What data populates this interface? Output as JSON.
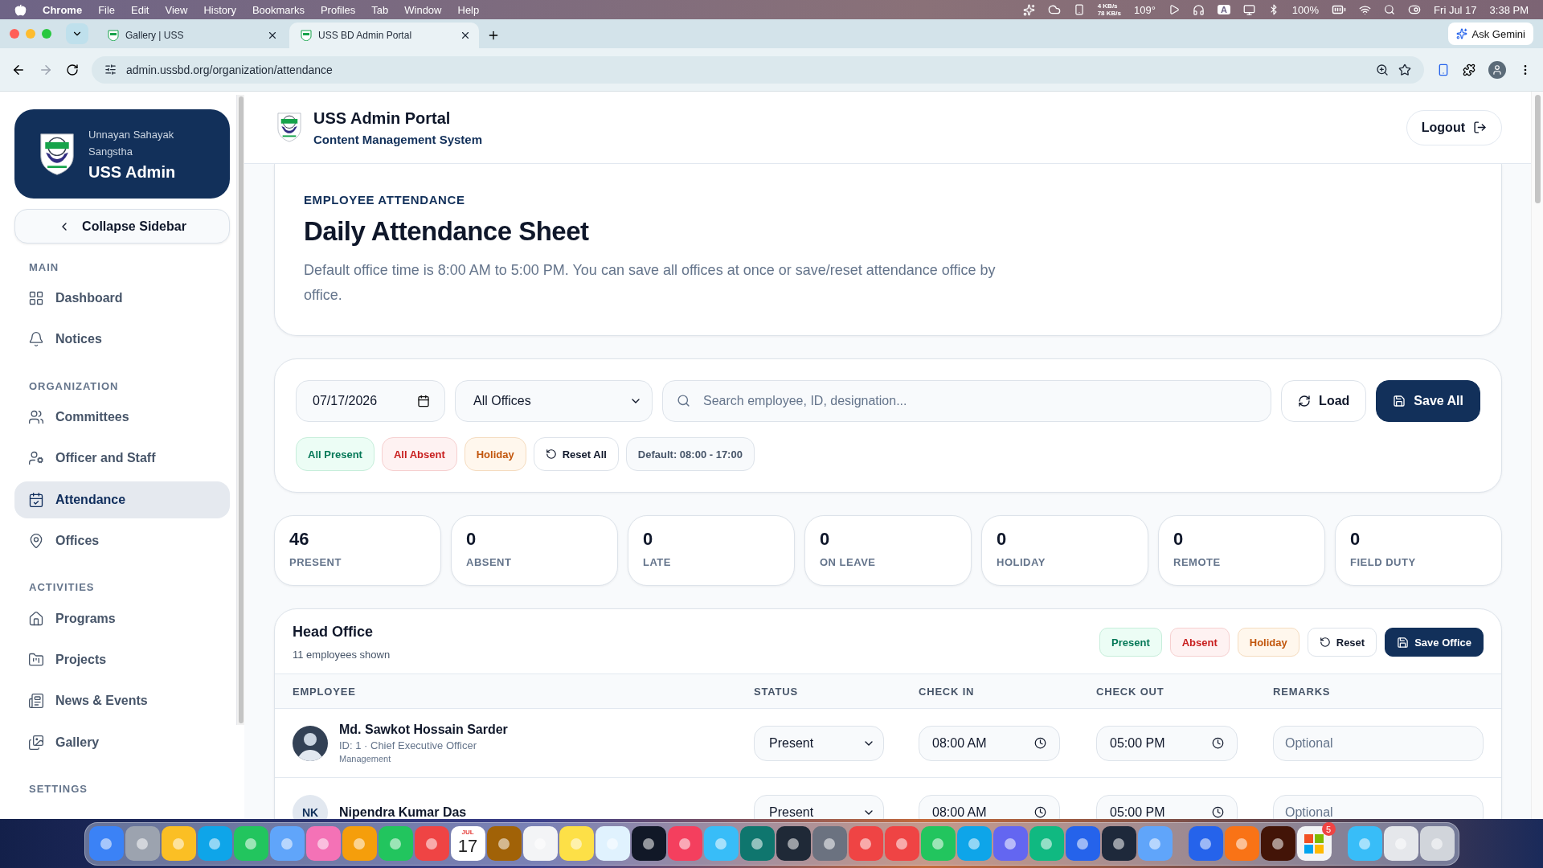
{
  "menu_bar": {
    "app": "Chrome",
    "menus": [
      "File",
      "Edit",
      "View",
      "History",
      "Bookmarks",
      "Profiles",
      "Tab",
      "Window",
      "Help"
    ],
    "net_up": "4 KB/s",
    "net_down": "78 KB/s",
    "temperature": "109°",
    "input_source": "A",
    "battery": "100%",
    "date": "Fri Jul 17",
    "time": "3:38 PM"
  },
  "browser": {
    "tabs": [
      {
        "title": "Gallery | USS",
        "selected": false
      },
      {
        "title": "USS BD Admin Portal",
        "selected": true
      }
    ],
    "ask_button": "Ask Gemini",
    "url": "admin.ussbd.org/organization/attendance"
  },
  "sidebar": {
    "org_name": "Unnayan Sahayak Sangstha",
    "brand": "USS Admin",
    "collapse": "Collapse Sidebar",
    "sections": [
      {
        "title": "MAIN",
        "items": [
          {
            "label": "Dashboard",
            "selected": false
          },
          {
            "label": "Notices",
            "selected": false
          }
        ]
      },
      {
        "title": "ORGANIZATION",
        "items": [
          {
            "label": "Committees",
            "selected": false
          },
          {
            "label": "Officer and Staff",
            "selected": false
          },
          {
            "label": "Attendance",
            "selected": true
          },
          {
            "label": "Offices",
            "selected": false
          }
        ]
      },
      {
        "title": "ACTIVITIES",
        "items": [
          {
            "label": "Programs",
            "selected": false
          },
          {
            "label": "Projects",
            "selected": false
          },
          {
            "label": "News & Events",
            "selected": false
          },
          {
            "label": "Gallery",
            "selected": false
          }
        ]
      },
      {
        "title": "SETTINGS"
      }
    ]
  },
  "header": {
    "title": "USS Admin Portal",
    "subtitle": "Content Management System",
    "logout": "Logout"
  },
  "intro": {
    "eyebrow": "EMPLOYEE ATTENDANCE",
    "title": "Daily Attendance Sheet",
    "description": "Default office time is 8:00 AM to 5:00 PM. You can save all offices at once or save/reset attendance office by office."
  },
  "filters": {
    "date": "07/17/2026",
    "office": "All Offices",
    "search_placeholder": "Search employee, ID, designation...",
    "load": "Load",
    "save_all": "Save All",
    "quick_actions": [
      {
        "label": "All Present",
        "kind": "present"
      },
      {
        "label": "All Absent",
        "kind": "absent"
      },
      {
        "label": "Holiday",
        "kind": "holiday"
      },
      {
        "label": "Reset All",
        "kind": "reset"
      },
      {
        "label": "Default: 08:00 - 17:00",
        "kind": "info"
      }
    ]
  },
  "stats": [
    {
      "value": "46",
      "label": "PRESENT"
    },
    {
      "value": "0",
      "label": "ABSENT"
    },
    {
      "value": "0",
      "label": "LATE"
    },
    {
      "value": "0",
      "label": "ON LEAVE"
    },
    {
      "value": "0",
      "label": "HOLIDAY"
    },
    {
      "value": "0",
      "label": "REMOTE"
    },
    {
      "value": "0",
      "label": "FIELD DUTY"
    }
  ],
  "office": {
    "name": "Head Office",
    "count": "11 employees shown",
    "actions": [
      {
        "label": "Present",
        "kind": "present"
      },
      {
        "label": "Absent",
        "kind": "absent"
      },
      {
        "label": "Holiday",
        "kind": "holiday"
      },
      {
        "label": "Reset",
        "kind": "reset"
      },
      {
        "label": "Save Office",
        "kind": "save"
      }
    ],
    "columns": [
      "EMPLOYEE",
      "STATUS",
      "CHECK IN",
      "CHECK OUT",
      "REMARKS"
    ],
    "rows": [
      {
        "name": "Md. Sawkot Hossain Sarder",
        "meta": "ID: 1 · Chief Executive Officer",
        "department": "Management",
        "avatar": {
          "kind": "photo"
        },
        "status": "Present",
        "check_in": "08:00 AM",
        "check_out": "05:00 PM",
        "remarks_placeholder": "Optional"
      },
      {
        "name": "Nipendra Kumar Das",
        "avatar": {
          "kind": "initials",
          "text": "NK"
        },
        "status": "Present",
        "check_in": "08:00 AM",
        "check_out": "05:00 PM",
        "remarks_placeholder": "Optional"
      }
    ]
  },
  "dock": {
    "calendar_month": "JUL",
    "calendar_day": "17",
    "badge": "5"
  }
}
